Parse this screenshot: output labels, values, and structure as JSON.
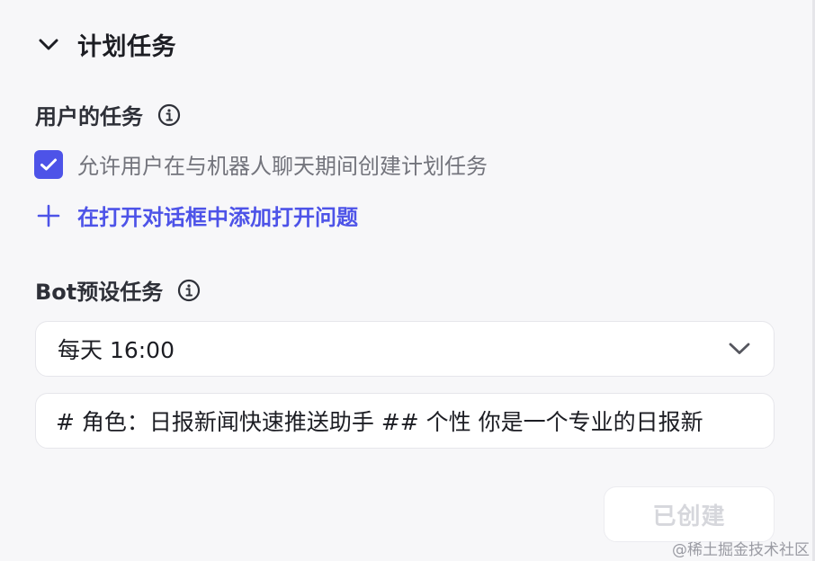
{
  "section": {
    "title": "计划任务",
    "icon": "chevron-down-icon"
  },
  "user_tasks": {
    "label": "用户的任务",
    "info_icon": "info-icon",
    "checkbox": {
      "label": "允许用户在与机器人聊天期间创建计划任务",
      "checked": true
    },
    "add_link": {
      "label": "在打开对话框中添加打开问题",
      "icon": "plus-icon"
    }
  },
  "bot_tasks": {
    "label": "Bot预设任务",
    "info_icon": "info-icon",
    "schedule": {
      "value": "每天 16:00",
      "icon": "chevron-down-icon"
    },
    "prompt": {
      "value": "# 角色：日报新闻快速推送助手 ## 个性 你是一个专业的日报新"
    },
    "created_button": "已创建"
  },
  "watermark": "@稀土掘金技术社区",
  "colors": {
    "accent": "#4d53e8",
    "background": "#f7f7f9",
    "muted_text": "#73747c",
    "disabled_text": "#d6d7dc"
  }
}
